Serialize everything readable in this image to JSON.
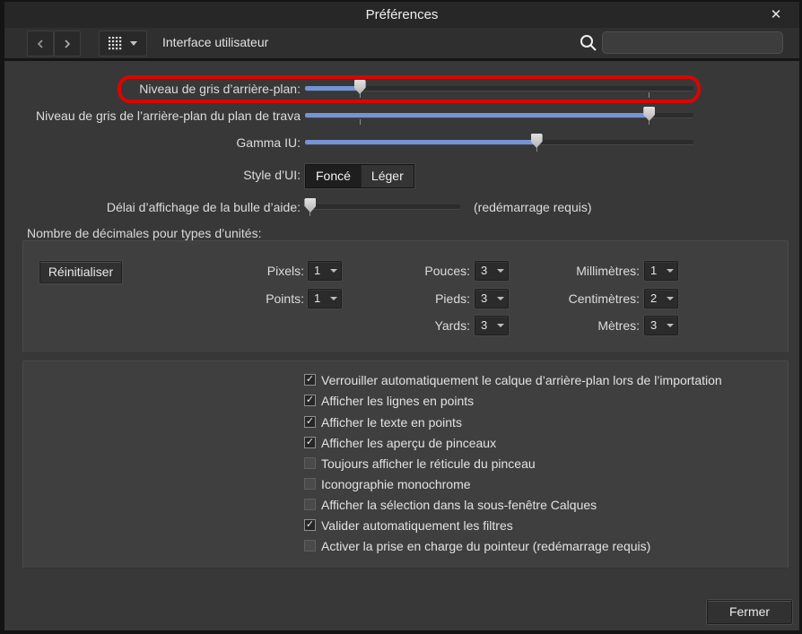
{
  "colors": {
    "accent_blue": "#7494d4",
    "highlight_red": "#dc0400",
    "window_bg": "#383838",
    "panel_bg": "#3f3f3f"
  },
  "title_bar": {
    "title": "Préférences",
    "close_icon": "✕"
  },
  "toolbar": {
    "back_icon": "chevron-left",
    "forward_icon": "chevron-right",
    "grid_icon": "grid-dots",
    "grid_caret_icon": "caret-down",
    "section_label": "Interface utilisateur",
    "search_icon": "magnifier",
    "search_value": "",
    "search_placeholder": ""
  },
  "sliders": [
    {
      "label": "Niveau de gris d’arrière-plan:",
      "value_pct": 14,
      "ticks_pct": [
        14,
        88.5
      ],
      "highlighted": true
    },
    {
      "label": "Niveau de gris de l’arrière-plan du plan de trava",
      "value_pct": 88.5,
      "ticks_pct": [
        14,
        88.5
      ],
      "highlighted": false
    },
    {
      "label": "Gamma IU:",
      "value_pct": 59.5,
      "ticks_pct": [
        59.5
      ],
      "highlighted": false
    }
  ],
  "ui_style": {
    "label": "Style d’UI:",
    "options": [
      {
        "label": "Foncé",
        "selected": true
      },
      {
        "label": "Léger",
        "selected": false
      }
    ]
  },
  "tooltip_delay": {
    "label": "Délai d’affichage de la bulle d’aide:",
    "value_pct": 2,
    "ticks_pct": [
      2
    ],
    "note": "(redémarrage requis)"
  },
  "decimals": {
    "heading": "Nombre de décimales pour types d’unités:",
    "reset_label": "Réinitialiser",
    "columns": [
      [
        {
          "label": "Pixels:",
          "value": "1"
        },
        {
          "label": "Points:",
          "value": "1"
        }
      ],
      [
        {
          "label": "Pouces:",
          "value": "3"
        },
        {
          "label": "Pieds:",
          "value": "3"
        },
        {
          "label": "Yards:",
          "value": "3"
        }
      ],
      [
        {
          "label": "Millimètres:",
          "value": "1"
        },
        {
          "label": "Centimètres:",
          "value": "2"
        },
        {
          "label": "Mètres:",
          "value": "3"
        }
      ]
    ]
  },
  "options": [
    {
      "label": "Verrouiller automatiquement le calque d’arrière-plan lors de l’importation",
      "checked": true
    },
    {
      "label": "Afficher les lignes en points",
      "checked": true
    },
    {
      "label": "Afficher le texte en points",
      "checked": true
    },
    {
      "label": "Afficher les aperçu de pinceaux",
      "checked": true
    },
    {
      "label": "Toujours afficher le réticule du pinceau",
      "checked": false
    },
    {
      "label": "Iconographie monochrome",
      "checked": false
    },
    {
      "label": "Afficher la sélection dans la sous-fenêtre Calques",
      "checked": false
    },
    {
      "label": "Valider automatiquement les filtres",
      "checked": true
    },
    {
      "label": "Activer la prise en charge du pointeur (redémarrage requis)",
      "checked": false
    }
  ],
  "footer": {
    "close_label": "Fermer"
  },
  "check_glyph": "✓"
}
